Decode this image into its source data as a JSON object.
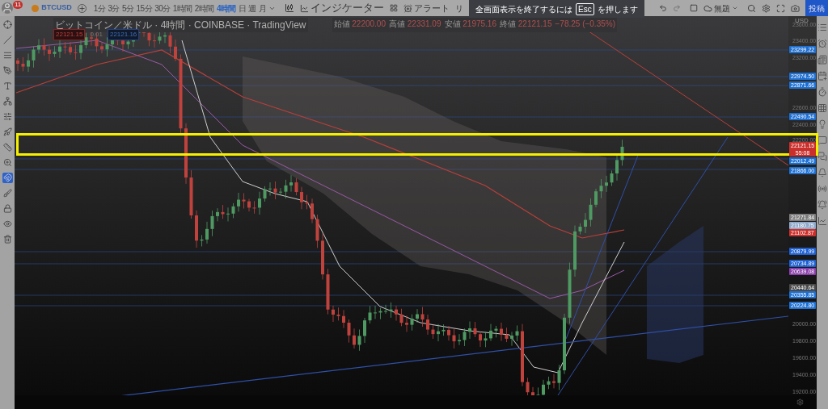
{
  "toolbar": {
    "badge": "11",
    "symbol": "BTCUSD",
    "timeframes": [
      {
        "label": "1分",
        "selected": false
      },
      {
        "label": "3分",
        "selected": false
      },
      {
        "label": "5分",
        "selected": false
      },
      {
        "label": "15分",
        "selected": false
      },
      {
        "label": "30分",
        "selected": false
      },
      {
        "label": "1時間",
        "selected": false
      },
      {
        "label": "2時間",
        "selected": false
      },
      {
        "label": "4時間",
        "selected": true
      },
      {
        "label": "日",
        "selected": false
      },
      {
        "label": "週",
        "selected": false
      },
      {
        "label": "月",
        "selected": false
      }
    ],
    "indicators": "インジケーター",
    "alerts": "アラート",
    "replay": "リ",
    "layout_name": "無題",
    "publish": "投稿"
  },
  "fullscreen_notice": {
    "before": "全画面表示を終了するには",
    "key": "Esc",
    "after": "を押します"
  },
  "legend": {
    "title": "ビットコイン／米ドル · 4時間 · COINBASE · TradingView",
    "ohlc": [
      {
        "label": "始値",
        "value": "22200.00"
      },
      {
        "label": "高値",
        "value": "22331.09"
      },
      {
        "label": "安値",
        "value": "21975.16"
      },
      {
        "label": "終値",
        "value": "22121.15"
      }
    ],
    "change": "−78.25 (−0.35%)"
  },
  "price_tags": {
    "bid": "22121.15",
    "spread": "0.01",
    "ask": "22121.16"
  },
  "left_tools": [
    {
      "kind": "crosshair",
      "selected": false
    },
    {
      "kind": "line",
      "selected": false
    },
    {
      "kind": "lines",
      "selected": false
    },
    {
      "kind": "pen",
      "selected": false
    },
    {
      "kind": "text",
      "selected": false
    },
    {
      "kind": "pattern",
      "selected": false
    },
    {
      "kind": "measure",
      "selected": false
    },
    {
      "kind": "rocket",
      "selected": false
    },
    {
      "kind": "ruler",
      "selected": false
    },
    {
      "kind": "zoom",
      "selected": false
    },
    {
      "kind": "magnet",
      "selected": true
    },
    {
      "kind": "draw",
      "selected": false
    },
    {
      "kind": "lock",
      "selected": false
    },
    {
      "kind": "eye",
      "selected": false
    },
    {
      "kind": "trash",
      "selected": false
    }
  ],
  "price_axis": {
    "currency": "USD",
    "labels": [
      {
        "text": "23600.00",
        "kind": "plain"
      },
      {
        "text": "23400.00",
        "kind": "plain"
      },
      {
        "text": "23299.22",
        "kind": "tag",
        "color": "#1e6fd0"
      },
      {
        "text": "23200.00",
        "kind": "plain"
      },
      {
        "text": "22974.50",
        "kind": "tag",
        "color": "#1e6fd0"
      },
      {
        "text": "22871.66",
        "kind": "tag",
        "color": "#1e6fd0"
      },
      {
        "text": "22600.00",
        "kind": "plain"
      },
      {
        "text": "22490.54",
        "kind": "tag",
        "color": "#1e6fd0"
      },
      {
        "text": "22400.00",
        "kind": "plain"
      },
      {
        "text": "22200.00",
        "kind": "plain"
      },
      {
        "text": "22121.15",
        "kind": "tag",
        "color": "#c9302c",
        "countdown": "55:08"
      },
      {
        "text": "22012.49",
        "kind": "tag",
        "color": "#1e6fd0"
      },
      {
        "text": "21866.00",
        "kind": "tag",
        "color": "#1e6fd0"
      },
      {
        "text": "21271.84",
        "kind": "tag",
        "color": "#7d7d7d"
      },
      {
        "text": "21180.75",
        "kind": "tag",
        "color": "#8fa9c9"
      },
      {
        "text": "21102.87",
        "kind": "tag",
        "color": "#c9302c"
      },
      {
        "text": "20879.99",
        "kind": "tag",
        "color": "#1e5fd0"
      },
      {
        "text": "20734.89",
        "kind": "tag",
        "color": "#1e5fd0"
      },
      {
        "text": "20639.08",
        "kind": "tag",
        "color": "#8a3fa8"
      },
      {
        "text": "20440.64",
        "kind": "tag",
        "color": "#4a4a4a"
      },
      {
        "text": "20355.85",
        "kind": "tag",
        "color": "#1e6fd0"
      },
      {
        "text": "20224.80",
        "kind": "tag",
        "color": "#1e6fd0"
      },
      {
        "text": "20000.00",
        "kind": "plain"
      },
      {
        "text": "19800.00",
        "kind": "plain"
      },
      {
        "text": "19600.00",
        "kind": "plain"
      },
      {
        "text": "19400.00",
        "kind": "plain"
      },
      {
        "text": "19200.00",
        "kind": "plain"
      }
    ]
  }
}
